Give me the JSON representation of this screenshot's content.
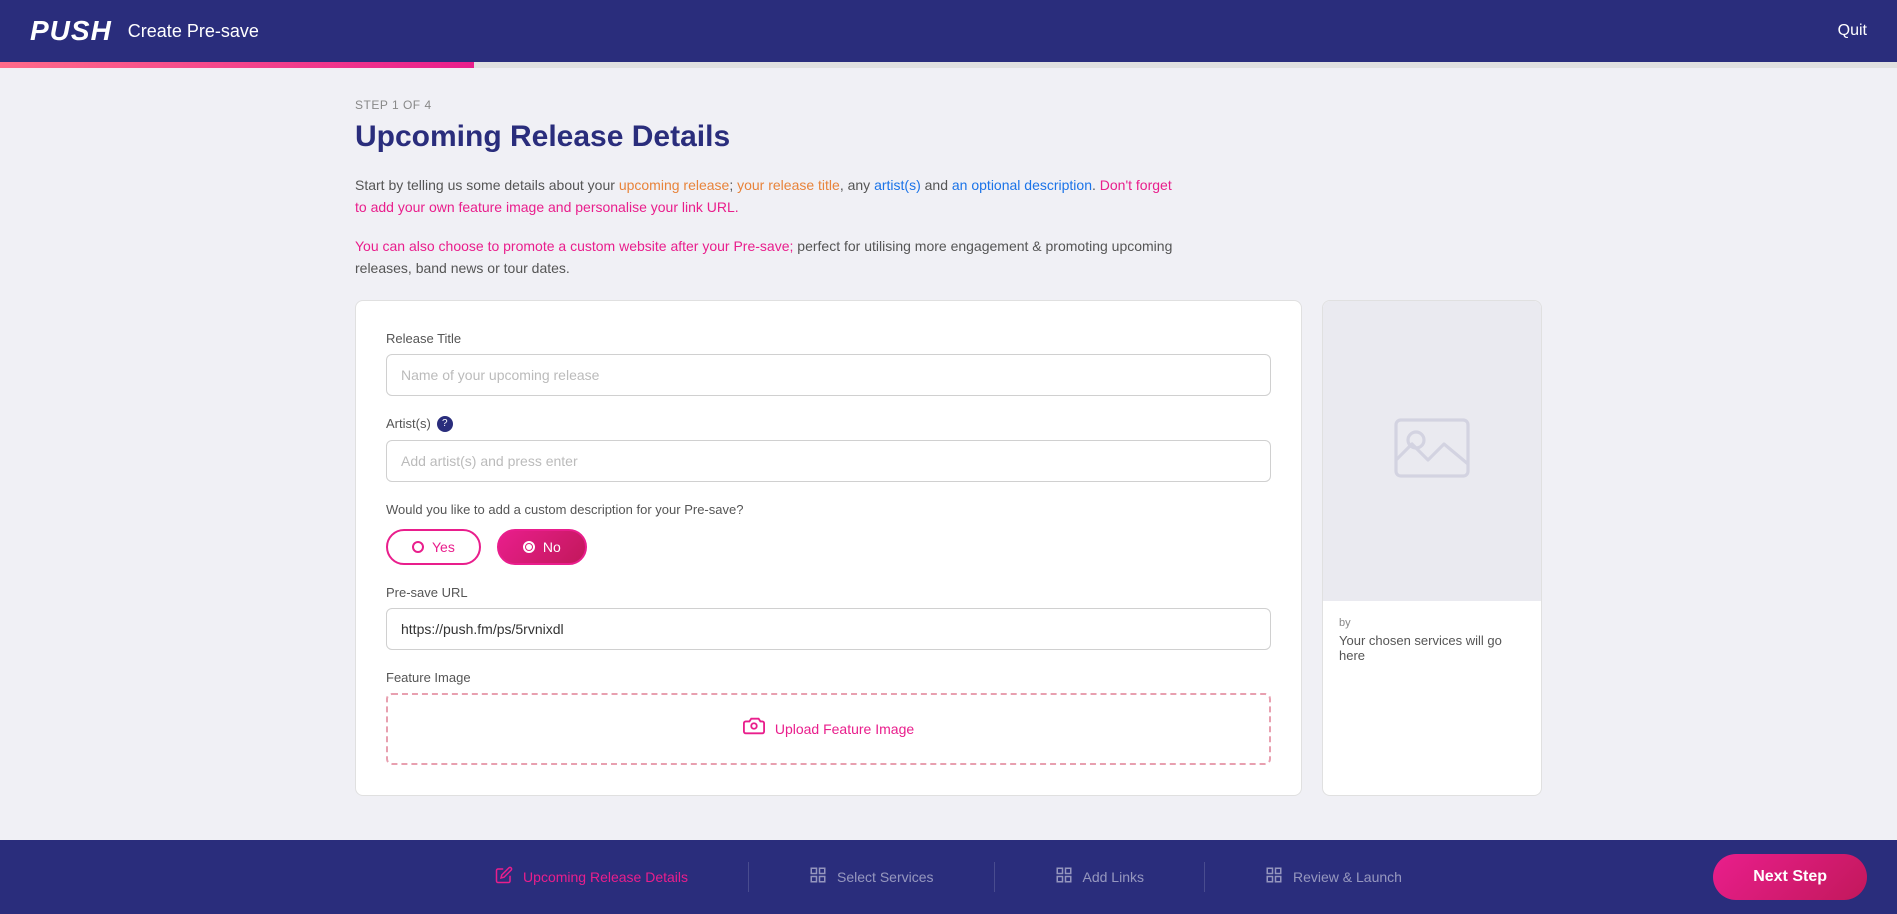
{
  "header": {
    "logo": "PUSH",
    "title": "Create Pre-save",
    "quit_label": "Quit"
  },
  "progress": {
    "step_current": 1,
    "step_total": 4,
    "step_label": "STEP 1 OF 4",
    "percent": 25
  },
  "page": {
    "title": "Upcoming Release Details",
    "description1": "Start by telling us some details about your upcoming release; your release title, any artist(s) and an optional description. Don't forget to add your own feature image and personalise your link URL.",
    "description2": "You can also choose to promote a custom website after your Pre-save; perfect for utilising more engagement & promoting upcoming releases, band news or tour dates."
  },
  "form": {
    "release_title_label": "Release Title",
    "release_title_placeholder": "Name of your upcoming release",
    "artists_label": "Artist(s)",
    "artists_help": "?",
    "artists_placeholder": "Add artist(s) and press enter",
    "description_question": "Would you like to add a custom description for your Pre-save?",
    "yes_label": "Yes",
    "no_label": "No",
    "presave_url_label": "Pre-save URL",
    "presave_url_value": "https://push.fm/ps/5rvnixdl",
    "feature_image_label": "Feature Image",
    "upload_label": "Upload Feature Image"
  },
  "preview": {
    "by_label": "by",
    "services_placeholder": "Your chosen services will go here"
  },
  "footer": {
    "steps": [
      {
        "id": "upcoming-release",
        "label": "Upcoming Release Details",
        "icon": "edit",
        "active": true
      },
      {
        "id": "select-services",
        "label": "Select Services",
        "icon": "grid",
        "active": false
      },
      {
        "id": "add-links",
        "label": "Add Links",
        "icon": "grid",
        "active": false
      },
      {
        "id": "review-launch",
        "label": "Review & Launch",
        "icon": "grid",
        "active": false
      }
    ],
    "next_step_label": "Next Step"
  }
}
